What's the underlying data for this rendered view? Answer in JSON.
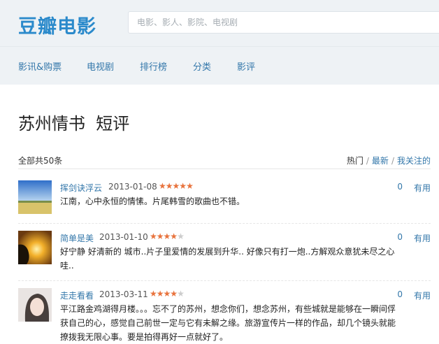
{
  "brand": {
    "logo": "豆瓣电影"
  },
  "search": {
    "placeholder": "电影、影人、影院、电视剧"
  },
  "nav": {
    "items": [
      "影讯&购票",
      "电视剧",
      "排行榜",
      "分类",
      "影评"
    ]
  },
  "page": {
    "title": "苏州情书  短评"
  },
  "list": {
    "total": "全部共50条",
    "sort": {
      "hot": "热门",
      "latest": "最新",
      "following": "我关注的",
      "sep": "/"
    }
  },
  "reviews": [
    {
      "author": "挥剑诀浮云",
      "date": "2013-01-08",
      "rating": 5,
      "content": "江南，心中永恒的情愫。片尾韩雪的歌曲也不错。",
      "votes": "0",
      "useful_label": "有用"
    },
    {
      "author": "简单是美",
      "date": "2013-01-10",
      "rating": 4,
      "content": "好宁静  好清新的  城市..片子里爱情的发展到升华.. 好像只有打一炮..方解观众意犹未尽之心哇..",
      "votes": "0",
      "useful_label": "有用"
    },
    {
      "author": "走走看看",
      "date": "2013-03-11",
      "rating": 4,
      "content": "平江路金鸡湖得月楼。。。忘不了的苏州，想念你们，想念苏州，有些城就是能够在一瞬间俘获自己的心，感觉自己前世一定与它有未解之缘。旅游宣传片一样的作品，却几个镜头就能撩拨我无限心事。要是拍得再好一点就好了。",
      "votes": "0",
      "useful_label": "有用"
    }
  ],
  "colors": {
    "brand": "#2b8acb",
    "link": "#3377aa",
    "star_on": "#e8733d",
    "star_off": "#cccccc",
    "header_bg": "#eef2f5"
  }
}
